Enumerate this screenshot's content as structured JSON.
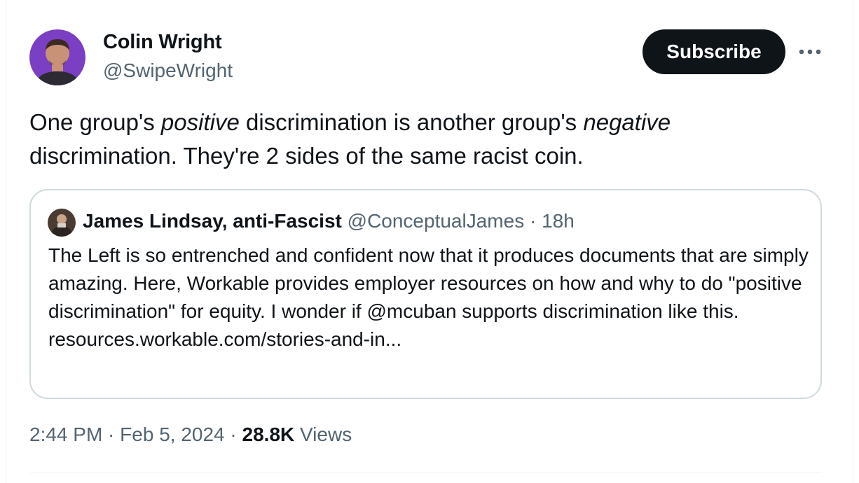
{
  "author": {
    "name": "Colin Wright",
    "handle": "@SwipeWright"
  },
  "actions": {
    "subscribe_label": "Subscribe",
    "more_icon": "more-horizontal-icon"
  },
  "tweet": {
    "text_1": "One group's ",
    "text_positive": "positive",
    "text_2": " discrimination is another group's ",
    "text_negative": "negative",
    "text_3": " discrimination. They're 2 sides of the same racist coin."
  },
  "quote": {
    "author_name": "James Lindsay, anti-Fascist",
    "author_handle": "@ConceptualJames",
    "separator": "·",
    "time_ago": "18h",
    "body": "The Left is so entrenched and confident now that it produces documents that are simply amazing. Here, Workable provides employer resources on how and why to do \"positive discrimination\" for equity. I wonder if @mcuban supports discrimination like this.",
    "link": "resources.workable.com/stories-and-in..."
  },
  "meta": {
    "time": "2:44 PM",
    "sep_1": " · ",
    "date": "Feb 5, 2024",
    "sep_2": " · ",
    "views_count": "28.8K",
    "views_label": "Views"
  },
  "colors": {
    "text_primary": "#0f1419",
    "text_secondary": "#536471",
    "border": "#cfd9de",
    "button_bg": "#0f1419",
    "avatar_bg": "#7b3fc4"
  }
}
